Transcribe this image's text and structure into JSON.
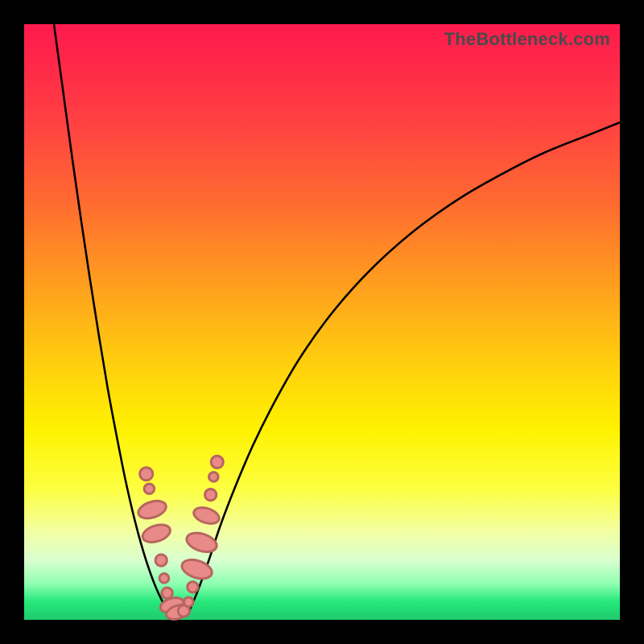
{
  "watermark": "TheBottleneck.com",
  "colors": {
    "frame": "#000000",
    "curve": "#000000",
    "bead_fill": "#e88a87",
    "bead_stroke": "#b86560",
    "gradient_top": "#ff1a4d",
    "gradient_mid": "#fff200",
    "gradient_bottom": "#1fc96e"
  },
  "chart_data": {
    "type": "line",
    "title": "",
    "xlabel": "",
    "ylabel": "",
    "xlim": [
      0,
      100
    ],
    "ylim": [
      0,
      100
    ],
    "series": [
      {
        "name": "left-curve",
        "x": [
          5.0,
          6.5,
          8.0,
          9.5,
          11.0,
          12.5,
          14.0,
          15.5,
          17.0,
          18.5,
          20.0,
          21.5,
          23.0,
          24.5
        ],
        "values": [
          100.0,
          89.0,
          78.0,
          67.5,
          57.5,
          48.0,
          39.0,
          31.0,
          23.5,
          17.0,
          11.5,
          7.0,
          3.5,
          1.0
        ]
      },
      {
        "name": "right-curve",
        "x": [
          27.5,
          29.0,
          31.0,
          33.0,
          35.5,
          38.5,
          42.0,
          46.0,
          50.5,
          55.5,
          61.0,
          67.0,
          73.5,
          80.5,
          87.5,
          95.0,
          100.0
        ],
        "values": [
          1.0,
          4.5,
          10.0,
          16.0,
          22.5,
          29.5,
          36.5,
          43.5,
          50.0,
          56.0,
          61.5,
          66.5,
          71.0,
          75.0,
          78.5,
          81.5,
          83.5
        ]
      },
      {
        "name": "valley-floor",
        "x": [
          24.5,
          25.5,
          26.5,
          27.5
        ],
        "values": [
          1.0,
          0.5,
          0.5,
          1.0
        ]
      }
    ],
    "markers": {
      "name": "bead-cluster",
      "points": [
        {
          "x": 20.5,
          "y": 24.5,
          "shape": "round",
          "r": 1.8
        },
        {
          "x": 21.0,
          "y": 22.0,
          "shape": "round",
          "r": 1.4
        },
        {
          "x": 21.5,
          "y": 18.5,
          "shape": "long",
          "r": 2.4
        },
        {
          "x": 22.2,
          "y": 14.5,
          "shape": "long",
          "r": 2.4
        },
        {
          "x": 23.0,
          "y": 10.0,
          "shape": "round",
          "r": 1.6
        },
        {
          "x": 23.5,
          "y": 7.0,
          "shape": "round",
          "r": 1.3
        },
        {
          "x": 24.0,
          "y": 4.5,
          "shape": "round",
          "r": 1.5
        },
        {
          "x": 24.8,
          "y": 2.5,
          "shape": "long",
          "r": 2.0
        },
        {
          "x": 25.8,
          "y": 1.3,
          "shape": "long",
          "r": 2.0
        },
        {
          "x": 26.8,
          "y": 1.5,
          "shape": "round",
          "r": 1.6
        },
        {
          "x": 27.6,
          "y": 3.0,
          "shape": "round",
          "r": 1.3
        },
        {
          "x": 28.3,
          "y": 5.5,
          "shape": "round",
          "r": 1.5
        },
        {
          "x": 29.0,
          "y": 8.5,
          "shape": "long",
          "r": 2.6
        },
        {
          "x": 29.8,
          "y": 13.0,
          "shape": "long",
          "r": 2.6
        },
        {
          "x": 30.6,
          "y": 17.5,
          "shape": "long",
          "r": 2.2
        },
        {
          "x": 31.3,
          "y": 21.0,
          "shape": "round",
          "r": 1.6
        },
        {
          "x": 31.8,
          "y": 24.0,
          "shape": "round",
          "r": 1.3
        },
        {
          "x": 32.4,
          "y": 26.5,
          "shape": "round",
          "r": 1.7
        }
      ]
    }
  }
}
